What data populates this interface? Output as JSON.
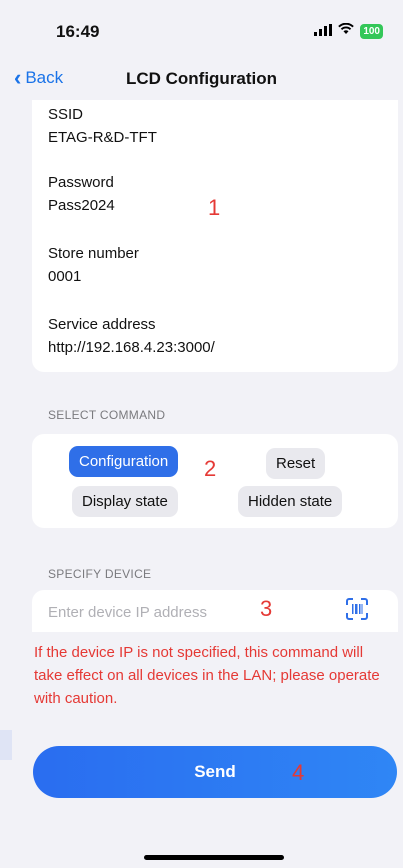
{
  "status_bar": {
    "time": "16:49",
    "signal": "::!!",
    "wifi": "wifi",
    "battery": "100"
  },
  "nav": {
    "back_label": "Back",
    "title": "LCD Configuration"
  },
  "fields": [
    {
      "label": "SSID",
      "value": "ETAG-R&D-TFT"
    },
    {
      "label": "Password",
      "value": "Pass2024"
    },
    {
      "label": "Store number",
      "value": "0001"
    },
    {
      "label": "Service address",
      "value": "http://192.168.4.23:3000/"
    }
  ],
  "annotations": {
    "a1": "1",
    "a2": "2",
    "a3": "3",
    "a4": "4"
  },
  "select_command": {
    "title": "SELECT COMMAND",
    "options": [
      "Configuration",
      "Reset",
      "Display state",
      "Hidden state"
    ],
    "selected": "Configuration"
  },
  "specify_device": {
    "title": "SPECIFY DEVICE",
    "placeholder": "Enter device IP address",
    "value": ""
  },
  "warning": "If the device IP is not specified, this command will take effect on all devices in the LAN; please operate with caution.",
  "send_label": "Send",
  "colors": {
    "accent": "#2f6fe8",
    "warning": "#e53935",
    "background": "#f2f2f7"
  }
}
